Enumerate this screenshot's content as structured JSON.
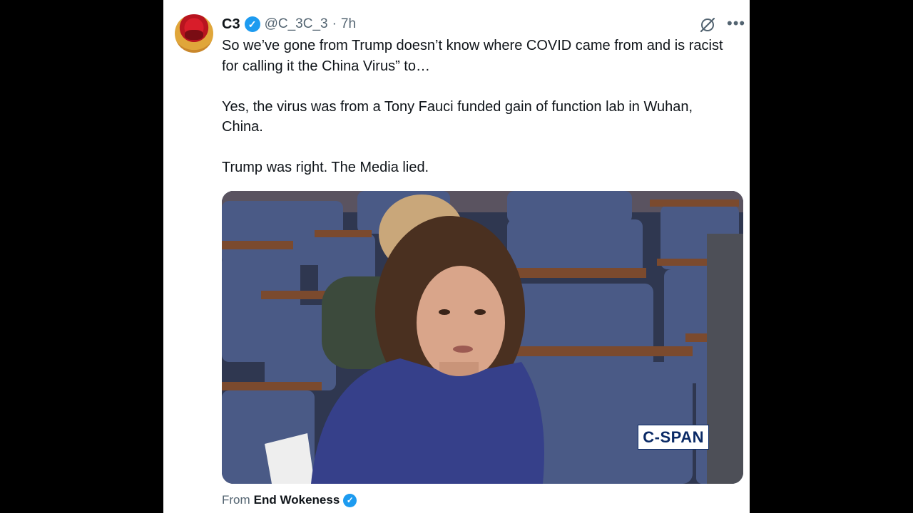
{
  "post": {
    "author": {
      "display_name": "C3",
      "handle": "@C_3C_3",
      "separator": "·",
      "time_ago": "7h",
      "verified": true,
      "avatar_icon": "profile-avatar"
    },
    "text_paragraphs": [
      "So we’ve gone from Trump doesn’t know where COVID came from and is racist for calling it the China Virus” to…",
      "Yes, the virus was from a Tony Fauci funded gain of function lab in Wuhan, China.",
      "Trump was right. The Media lied."
    ],
    "media": {
      "type": "video",
      "watermark": "C-SPAN"
    },
    "source": {
      "prefix": "From",
      "name": "End Wokeness",
      "verified": true
    },
    "icons": {
      "grok": "grok-icon",
      "more": "more-options-icon",
      "verified": "verified-badge-icon"
    }
  },
  "colors": {
    "background": "#000000",
    "card": "#ffffff",
    "text_primary": "#0f1419",
    "text_secondary": "#536471",
    "verified_blue": "#1d9bf0"
  }
}
